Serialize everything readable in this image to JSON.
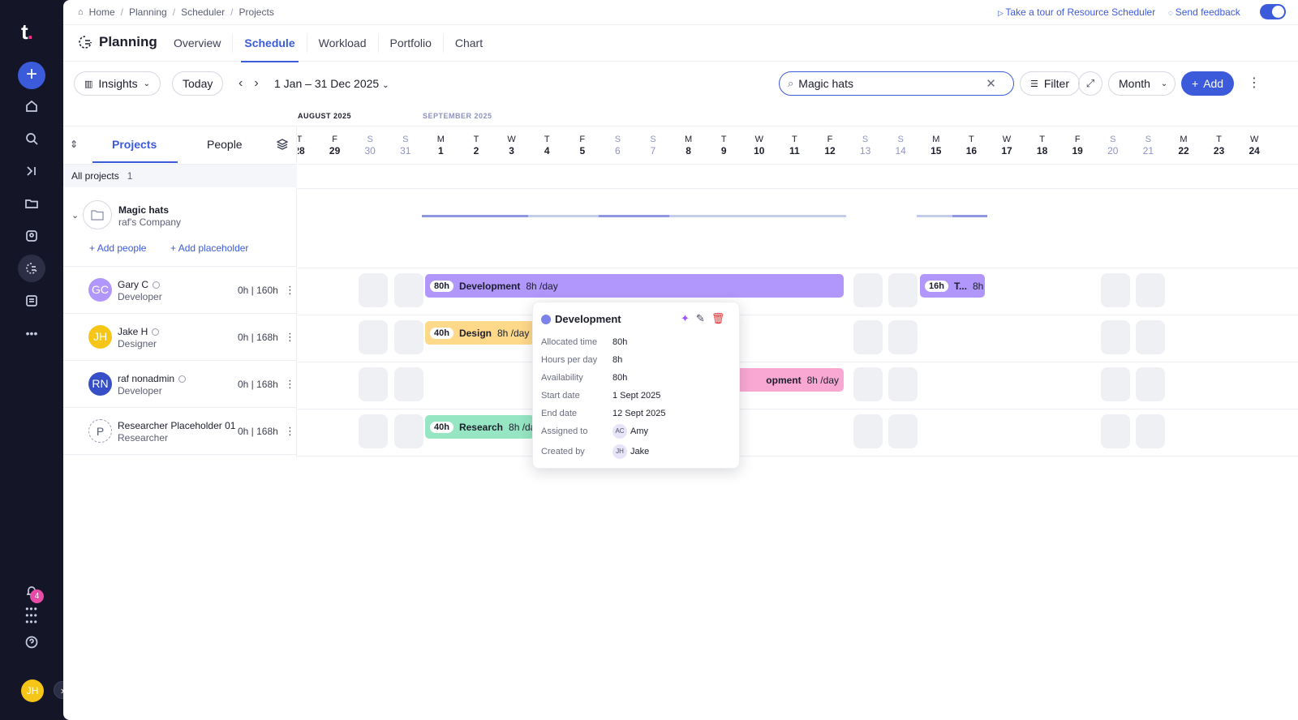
{
  "nav": {
    "logo": "t",
    "notifications_count": "4",
    "user_initials": "JH",
    "icons": [
      "plus-icon",
      "home-icon",
      "search-icon",
      "collapse-icon",
      "folder-icon",
      "team-icon",
      "planning-icon",
      "reports-icon",
      "more-icon",
      "bell-icon",
      "apps-icon",
      "help-icon"
    ]
  },
  "breadcrumb": [
    "Home",
    "Planning",
    "Scheduler",
    "Projects"
  ],
  "header": {
    "tour_link": "Take a tour of Resource Scheduler",
    "feedback_link": "Send feedback",
    "page_title": "Planning",
    "tabs": [
      "Overview",
      "Schedule",
      "Workload",
      "Portfolio",
      "Chart"
    ],
    "active_tab": "Schedule"
  },
  "toolbar": {
    "insights_label": "Insights",
    "today_label": "Today",
    "date_range": "1 Jan – 31 Dec 2025",
    "search_value": "Magic hats",
    "filter_label": "Filter",
    "view_label": "Month",
    "add_label": "Add"
  },
  "left_panel": {
    "tabs": [
      "Projects",
      "People"
    ],
    "all_projects_label": "All projects",
    "all_projects_count": "1",
    "project": {
      "name": "Magic hats",
      "company": "raf's Company"
    },
    "add_people_label": "Add people",
    "add_placeholder_label": "Add placeholder",
    "people": [
      {
        "initials": "GC",
        "name": "Gary C",
        "role": "Developer",
        "hours": "0h | 160h",
        "color": "#b197fc"
      },
      {
        "initials": "JH",
        "name": "Jake H",
        "role": "Designer",
        "hours": "0h | 168h",
        "color": "#f5c518"
      },
      {
        "initials": "RN",
        "name": "raf nonadmin",
        "role": "Developer",
        "hours": "0h | 168h",
        "color": "#364fc7"
      },
      {
        "initials": "P",
        "name": "Researcher Placeholder 01",
        "role": "Researcher",
        "hours": "0h | 168h",
        "color": "#ffffff"
      }
    ]
  },
  "timeline": {
    "months": [
      "AUGUST 2025",
      "SEPTEMBER 2025"
    ],
    "days": [
      {
        "l": "T",
        "n": "28"
      },
      {
        "l": "F",
        "n": "29"
      },
      {
        "l": "S",
        "n": "30",
        "we": true
      },
      {
        "l": "S",
        "n": "31",
        "we": true
      },
      {
        "l": "M",
        "n": "1"
      },
      {
        "l": "T",
        "n": "2"
      },
      {
        "l": "W",
        "n": "3"
      },
      {
        "l": "T",
        "n": "4"
      },
      {
        "l": "F",
        "n": "5"
      },
      {
        "l": "S",
        "n": "6",
        "we": true
      },
      {
        "l": "S",
        "n": "7",
        "we": true
      },
      {
        "l": "M",
        "n": "8"
      },
      {
        "l": "T",
        "n": "9"
      },
      {
        "l": "W",
        "n": "10"
      },
      {
        "l": "T",
        "n": "11"
      },
      {
        "l": "F",
        "n": "12"
      },
      {
        "l": "S",
        "n": "13",
        "we": true
      },
      {
        "l": "S",
        "n": "14",
        "we": true
      },
      {
        "l": "M",
        "n": "15"
      },
      {
        "l": "T",
        "n": "16"
      },
      {
        "l": "W",
        "n": "17"
      },
      {
        "l": "T",
        "n": "18"
      },
      {
        "l": "F",
        "n": "19"
      },
      {
        "l": "S",
        "n": "20",
        "we": true
      },
      {
        "l": "S",
        "n": "21",
        "we": true
      },
      {
        "l": "M",
        "n": "22"
      },
      {
        "l": "T",
        "n": "23"
      },
      {
        "l": "W",
        "n": "24"
      }
    ],
    "allocations": [
      {
        "person": 0,
        "hours": "80h",
        "task": "Development",
        "rate": "8h /day",
        "color": "#b197fc"
      },
      {
        "person": 0,
        "hours": "16h",
        "task": "T...",
        "rate": "8h",
        "color": "#b197fc"
      },
      {
        "person": 1,
        "hours": "40h",
        "task": "Design",
        "rate": "8h /day",
        "color": "#ffd98a"
      },
      {
        "person": 2,
        "hours": "",
        "task": "opment",
        "rate": "8h /day",
        "color": "#f9a8d4"
      },
      {
        "person": 3,
        "hours": "40h",
        "task": "Research",
        "rate": "8h /da",
        "color": "#96e6c3"
      }
    ]
  },
  "popover": {
    "title": "Development",
    "fields": [
      {
        "label": "Allocated time",
        "value": "80h"
      },
      {
        "label": "Hours per day",
        "value": "8h"
      },
      {
        "label": "Availability",
        "value": "80h"
      },
      {
        "label": "Start date",
        "value": "1 Sept 2025"
      },
      {
        "label": "End date",
        "value": "12 Sept 2025"
      }
    ],
    "assigned_label": "Assigned to",
    "assigned_initials": "AC",
    "assigned_name": "Amy",
    "created_label": "Created by",
    "created_initials": "JH",
    "created_name": "Jake"
  }
}
